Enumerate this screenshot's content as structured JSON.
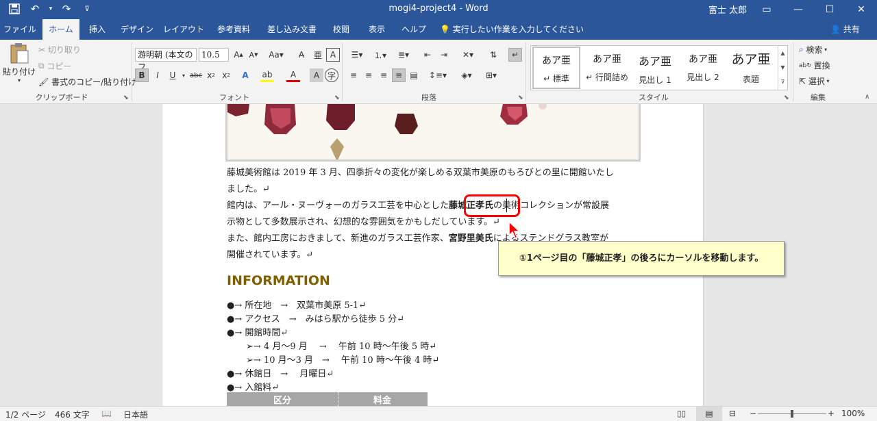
{
  "window": {
    "doc_title": "mogi4-project4 - Word",
    "user": "富士 太郎"
  },
  "tabs": [
    "ファイル",
    "ホーム",
    "挿入",
    "デザイン",
    "レイアウト",
    "参考資料",
    "差し込み文書",
    "校閲",
    "表示",
    "ヘルプ"
  ],
  "tell_me": "実行したい作業を入力してください",
  "share": "共有",
  "clipboard": {
    "paste": "貼り付け",
    "cut": "切り取り",
    "copy": "コピー",
    "format_painter": "書式のコピー/貼り付け",
    "label": "クリップボード"
  },
  "font": {
    "name": "游明朝 (本文のフ",
    "size": "10.5",
    "label": "フォント"
  },
  "paragraph": {
    "label": "段落"
  },
  "styles": {
    "items": [
      {
        "sample": "あア亜",
        "name": "↵ 標準"
      },
      {
        "sample": "あア亜",
        "name": "↵ 行間詰め"
      },
      {
        "sample": "あア亜",
        "name": "見出し 1"
      },
      {
        "sample": "あア亜",
        "name": "見出し 2"
      },
      {
        "sample": "あア亜",
        "name": "表題"
      }
    ],
    "label": "スタイル"
  },
  "editing": {
    "find": "検索",
    "replace": "置換",
    "select": "選択",
    "label": "編集"
  },
  "document": {
    "para1_line1": "藤城美術館は 2019 年 3 月、四季折々の変化が楽しめる双葉市美原のもろびとの里に開館いたし",
    "para1_line2": "ました。↵",
    "para2_line1_a": "館内は、アール・ヌーヴォーのガラス工芸を中心とした",
    "para2_name": "藤城正孝氏",
    "para2_line1_b": "の美術コレクションが常設展",
    "para2_line2": "示物として多数展示され、幻想的な雰囲気をかもしだしています。↵",
    "para3_line1_a": "また、館内工房におきまして、新進のガラス工芸作家、",
    "para3_name": "宮野里美氏",
    "para3_line1_b": "によるステンドグラス教室が",
    "para3_line2": "開催されています。↵",
    "info_heading": "INFORMATION",
    "list": [
      "●→ 所在地　→　双葉市美原 5-1↵",
      "●→ アクセス　→　みはら駅から徒歩 5 分↵",
      "●→ 開館時間↵",
      "➢→ 4 月～9 月　 →　 午前 10 時～午後 5 時↵",
      "➢→ 10 月～3 月　→　 午前 10 時～午後 4 時↵",
      "●→ 休館日　→　 月曜日↵",
      "●→ 入館料↵"
    ],
    "table_headers": [
      "区分",
      "料金"
    ]
  },
  "callout_text": "①1ページ目の「藤城正孝」の後ろにカーソルを移動します。",
  "status": {
    "page": "1/2 ページ",
    "words": "466 文字",
    "language": "日本語",
    "zoom": "100%"
  },
  "colors": {
    "accent": "#2b579a",
    "heading": "#7f6000",
    "highlight": "#ff0000",
    "callout_bg": "#ffffcc"
  }
}
